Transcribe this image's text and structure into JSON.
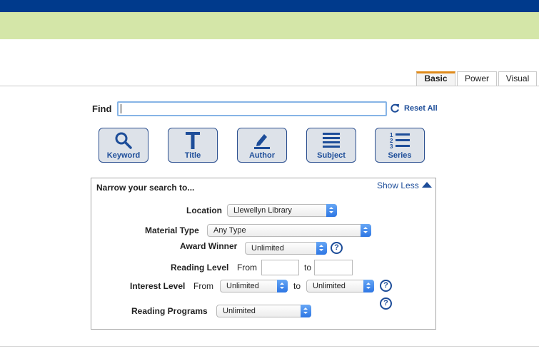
{
  "tabs": [
    {
      "label": "Basic",
      "active": true
    },
    {
      "label": "Power",
      "active": false
    },
    {
      "label": "Visual",
      "active": false
    }
  ],
  "find": {
    "label": "Find",
    "value": "",
    "reset_label": "Reset All"
  },
  "search_buttons": [
    {
      "label": "Keyword",
      "icon": "magnifier-icon"
    },
    {
      "label": "Title",
      "icon": "title-t-icon"
    },
    {
      "label": "Author",
      "icon": "pen-icon"
    },
    {
      "label": "Subject",
      "icon": "lines-icon"
    },
    {
      "label": "Series",
      "icon": "numbered-list-icon"
    }
  ],
  "narrow": {
    "title": "Narrow your search to...",
    "toggle_label": "Show Less",
    "location": {
      "label": "Location",
      "value": "Llewellyn Library"
    },
    "material_type": {
      "label": "Material Type",
      "value": "Any Type"
    },
    "award_winner": {
      "label": "Award Winner",
      "value": "Unlimited"
    },
    "reading_level": {
      "label": "Reading Level",
      "from": "From",
      "to": "to",
      "from_value": "",
      "to_value": ""
    },
    "interest_level": {
      "label": "Interest Level",
      "from": "From",
      "to": "to",
      "from_value": "Unlimited",
      "to_value": "Unlimited"
    },
    "reading_programs": {
      "label": "Reading Programs",
      "value": "Unlimited"
    },
    "help_glyph": "?"
  },
  "colors": {
    "top_bar": "#003a8c",
    "green_bar": "#d4e6a8",
    "accent_tab": "#e08b1a",
    "link_blue": "#1d4d99"
  }
}
